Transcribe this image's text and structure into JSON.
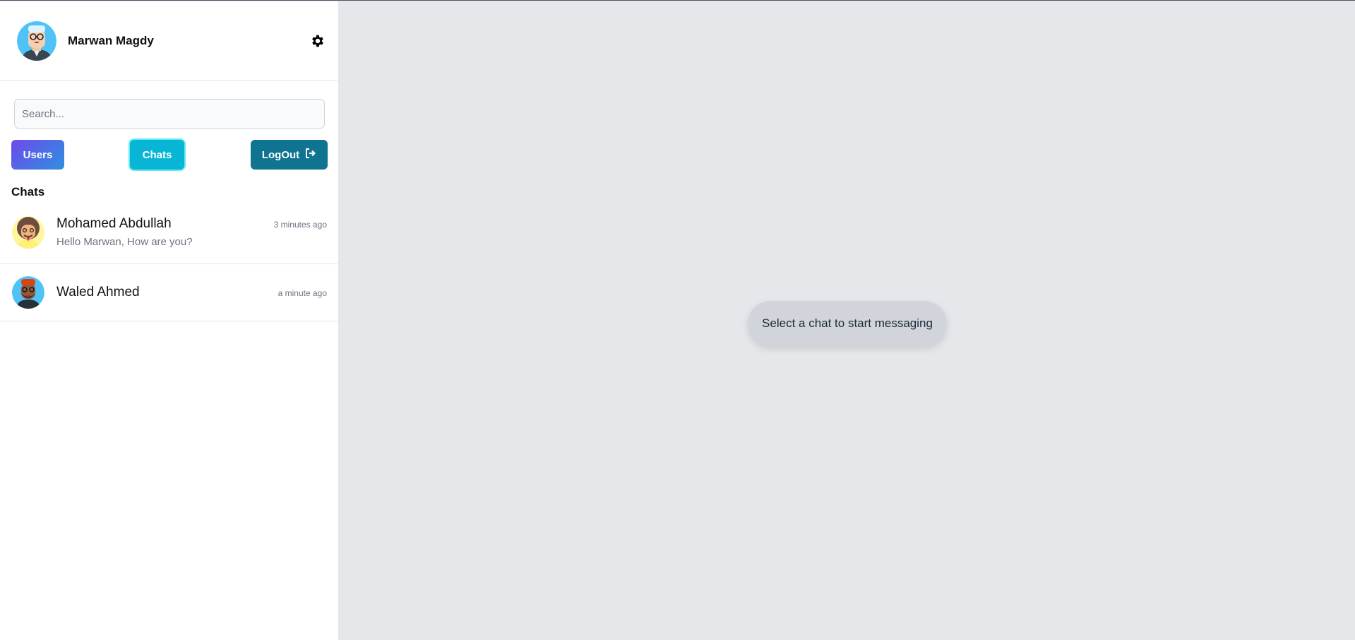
{
  "profile": {
    "name": "Marwan Magdy",
    "avatar_icon": "user-avatar-glasses",
    "settings_icon": "gear-icon"
  },
  "search": {
    "placeholder": "Search...",
    "value": ""
  },
  "buttons": {
    "users_label": "Users",
    "chats_label": "Chats",
    "logout_label": "LogOut",
    "logout_icon": "sign-out-icon"
  },
  "chats": {
    "title": "Chats",
    "items": [
      {
        "name": "Mohamed Abdullah",
        "time": "3 minutes ago",
        "last_message": "Hello Marwan, How are you?"
      },
      {
        "name": "Waled Ahmed",
        "time": "a minute ago",
        "last_message": ""
      }
    ]
  },
  "main": {
    "empty_state": "Select a chat to start messaging"
  },
  "colors": {
    "active_tab": "#06b6d4",
    "logout": "#0e7490",
    "users_gradient_start": "#6d4aea",
    "users_gradient_end": "#2f8fe0",
    "background": "#e5e7eb"
  }
}
